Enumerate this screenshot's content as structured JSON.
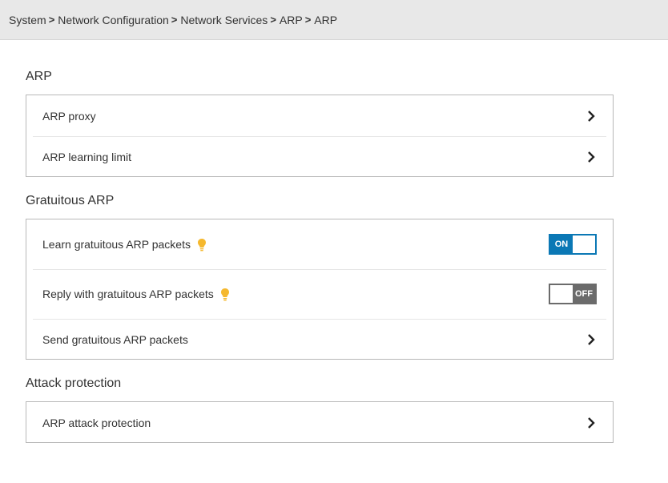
{
  "breadcrumb": [
    "System",
    "Network Configuration",
    "Network Services",
    "ARP",
    "ARP"
  ],
  "sections": {
    "arp": {
      "title": "ARP",
      "items": [
        "ARP proxy",
        "ARP learning limit"
      ]
    },
    "gratuitous": {
      "title": "Gratuitous ARP",
      "learn_label": "Learn gratuitous ARP packets",
      "learn_toggle": "ON",
      "reply_label": "Reply with gratuitous ARP packets",
      "reply_toggle": "OFF",
      "send_label": "Send gratuitous ARP packets"
    },
    "attack": {
      "title": "Attack protection",
      "items": [
        "ARP attack protection"
      ]
    }
  },
  "colors": {
    "accent": "#0b78b5",
    "toggle_off": "#6b6b6b",
    "tip_bulb": "#f5b82e"
  },
  "icons": {
    "chevron": "chevron-right-icon",
    "tip": "lightbulb-icon"
  }
}
